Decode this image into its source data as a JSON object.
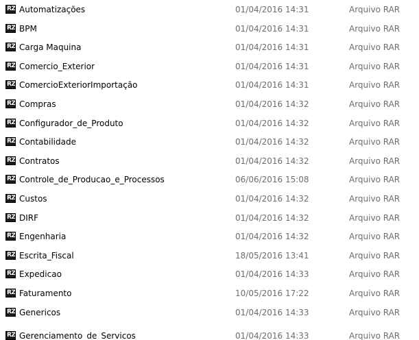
{
  "icon_name": "winrar-archive-icon",
  "icon_glyph": "RZ",
  "files": [
    {
      "name": "Automatizações",
      "date": "01/04/2016 14:31",
      "type": "Arquivo RAR"
    },
    {
      "name": "BPM",
      "date": "01/04/2016 14:31",
      "type": "Arquivo RAR"
    },
    {
      "name": "Carga Maquina",
      "date": "01/04/2016 14:31",
      "type": "Arquivo RAR"
    },
    {
      "name": "Comercio_Exterior",
      "date": "01/04/2016 14:31",
      "type": "Arquivo RAR"
    },
    {
      "name": "ComercioExteriorImportação",
      "date": "01/04/2016 14:31",
      "type": "Arquivo RAR"
    },
    {
      "name": "Compras",
      "date": "01/04/2016 14:32",
      "type": "Arquivo RAR"
    },
    {
      "name": "Configurador_de_Produto",
      "date": "01/04/2016 14:32",
      "type": "Arquivo RAR"
    },
    {
      "name": "Contabilidade",
      "date": "01/04/2016 14:32",
      "type": "Arquivo RAR"
    },
    {
      "name": "Contratos",
      "date": "01/04/2016 14:32",
      "type": "Arquivo RAR"
    },
    {
      "name": "Controle_de_Producao_e_Processos",
      "date": "06/06/2016 15:08",
      "type": "Arquivo RAR"
    },
    {
      "name": "Custos",
      "date": "01/04/2016 14:32",
      "type": "Arquivo RAR"
    },
    {
      "name": "DIRF",
      "date": "01/04/2016 14:32",
      "type": "Arquivo RAR"
    },
    {
      "name": "Engenharia",
      "date": "01/04/2016 14:32",
      "type": "Arquivo RAR"
    },
    {
      "name": "Escrita_Fiscal",
      "date": "18/05/2016 13:41",
      "type": "Arquivo RAR"
    },
    {
      "name": "Expedicao",
      "date": "01/04/2016 14:33",
      "type": "Arquivo RAR"
    },
    {
      "name": "Faturamento",
      "date": "10/05/2016 17:22",
      "type": "Arquivo RAR"
    },
    {
      "name": "Genericos",
      "date": "01/04/2016 14:33",
      "type": "Arquivo RAR"
    },
    {
      "name": "Gerenciamento_de_Servicos",
      "date": "01/04/2016 14:33",
      "type": "Arquivo RAR"
    }
  ]
}
